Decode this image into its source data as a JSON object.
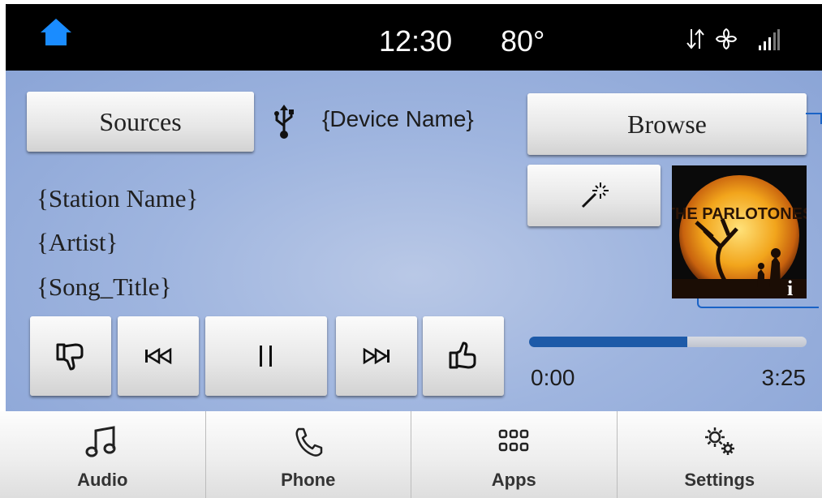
{
  "status_bar": {
    "time": "12:30",
    "temperature": "80°",
    "home_icon": "home-icon",
    "icons": [
      "transfer-icon",
      "fan-icon",
      "signal-icon"
    ],
    "accent_color": "#1a8cff"
  },
  "source": {
    "sources_label": "Sources",
    "device_name": "{Device Name}",
    "device_icon": "usb-icon",
    "browse_label": "Browse"
  },
  "now_playing": {
    "station": "{Station Name}",
    "artist": "{Artist}",
    "song_title": "{Song_Title}",
    "album_art": {
      "band_name": "THE PARLOTONES",
      "info_icon": "info-icon"
    }
  },
  "transport": {
    "buttons": [
      "thumbs-down-icon",
      "previous-icon",
      "pause-icon",
      "next-icon",
      "thumbs-up-icon"
    ]
  },
  "progress": {
    "elapsed": "0:00",
    "duration": "3:25",
    "fraction": 0.57,
    "fill_color": "#1d5aa8"
  },
  "tabs": [
    {
      "label": "Audio",
      "icon": "music-note-icon"
    },
    {
      "label": "Phone",
      "icon": "phone-icon"
    },
    {
      "label": "Apps",
      "icon": "apps-grid-icon"
    },
    {
      "label": "Settings",
      "icon": "gears-icon"
    }
  ],
  "colors": {
    "background_blue": "#9fb5df",
    "status_bar": "#000000"
  }
}
